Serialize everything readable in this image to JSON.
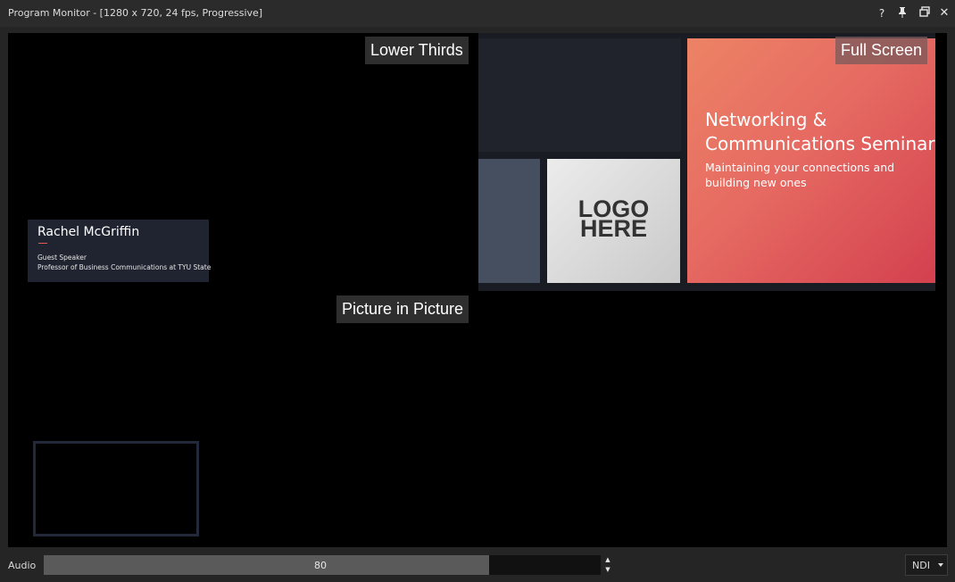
{
  "window": {
    "title": "Program Monitor - [1280 x 720, 24 fps, Progressive]",
    "icons": {
      "help": "?",
      "pin": "pin-icon",
      "restore": "restore-icon",
      "close": "✕"
    }
  },
  "monitor": {
    "labels": {
      "lower_thirds": "Lower Thirds",
      "full_screen": "Full Screen",
      "picture_in_picture": "Picture in Picture"
    },
    "full_screen_card": {
      "title": "Networking & Communications Seminar",
      "subtitle": "Maintaining your connections and building new ones"
    },
    "logo": {
      "line1": "LOGO",
      "line2": "HERE"
    },
    "lower_third": {
      "name": "Rachel McGriffin",
      "role": "Guest Speaker",
      "description": "Professor of Business Communications at TYU State"
    }
  },
  "audio": {
    "label": "Audio",
    "value": "80",
    "level": 0.8
  },
  "output": {
    "selected": "NDI"
  },
  "colors": {
    "full_screen_gradient_start": "#ec8365",
    "full_screen_gradient_end": "#d3404f",
    "accent_line": "#e05a5a"
  }
}
